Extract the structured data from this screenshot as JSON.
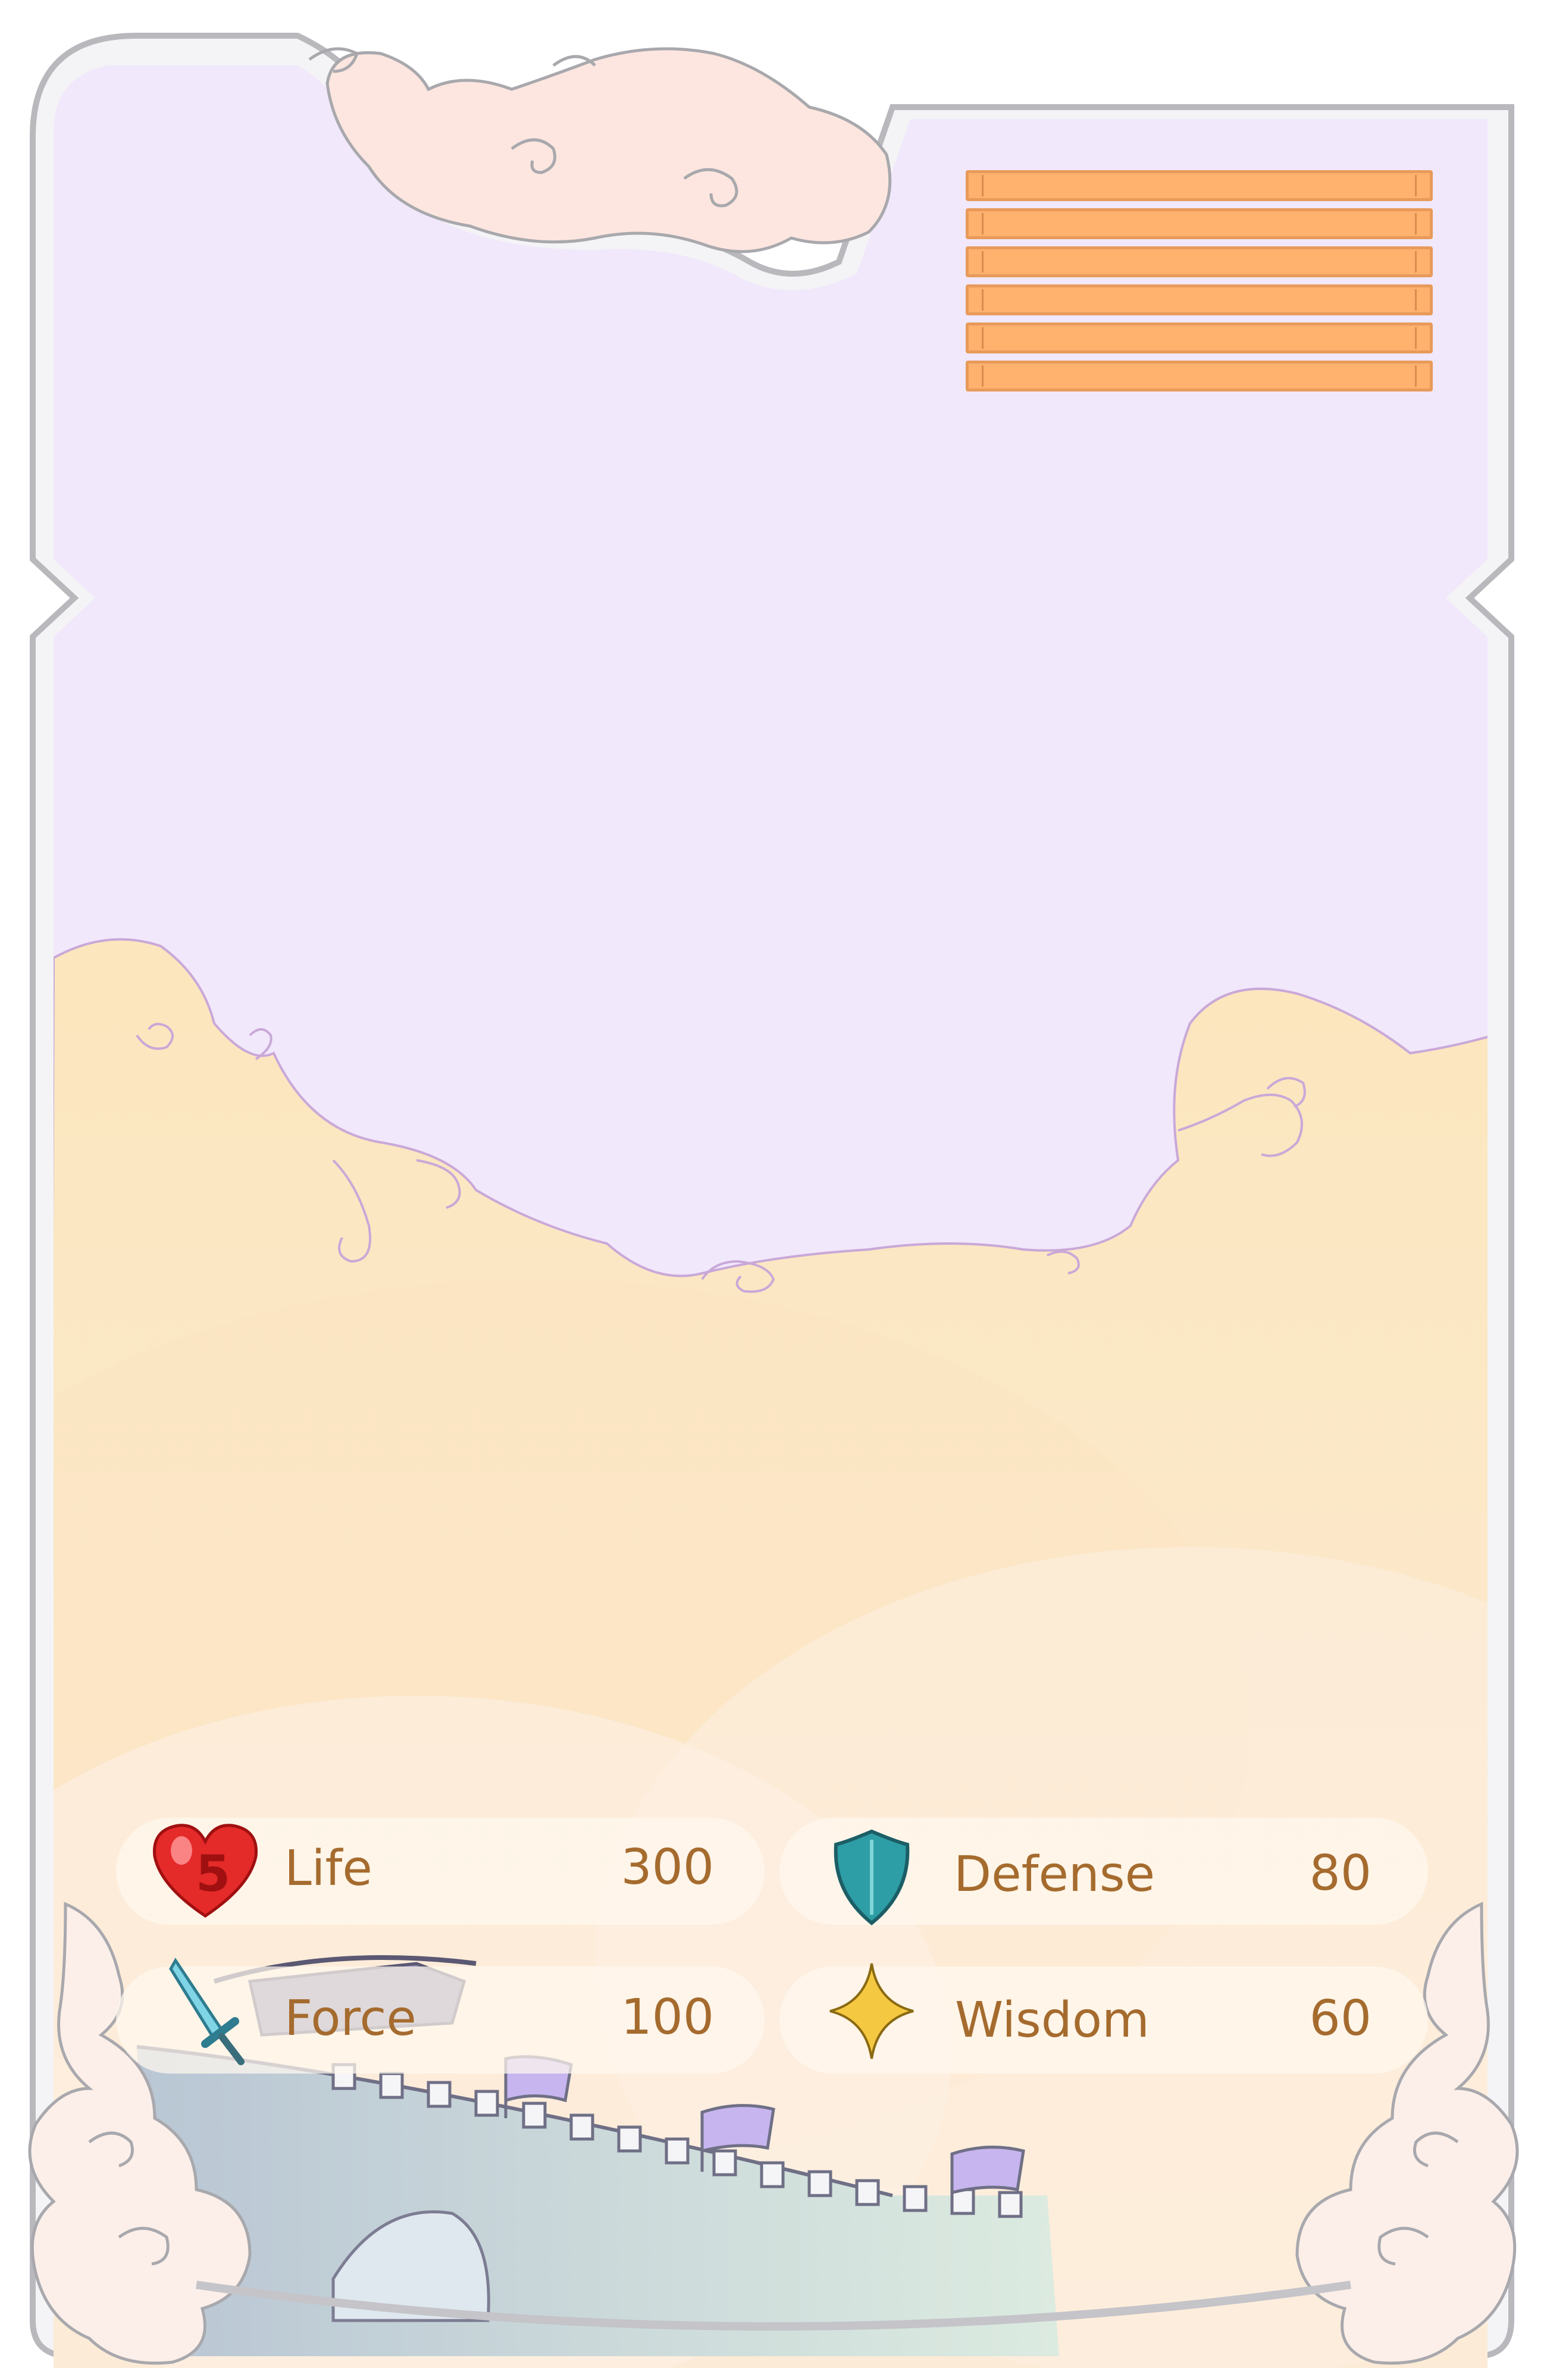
{
  "card": {
    "name_plate_planks": 6,
    "colors": {
      "frame": "#c9c9cc",
      "sky": "#f1e8fb",
      "cloud_sea": "#fbe6c2",
      "plank": "#ffb16e",
      "label_text": "#a56b2e",
      "wall_flag": "#c6b5ee"
    }
  },
  "stats": {
    "life": {
      "label": "Life",
      "value": "300",
      "icon": "heart-icon",
      "badge": "5"
    },
    "defense": {
      "label": "Defense",
      "value": "80",
      "icon": "shield-icon"
    },
    "force": {
      "label": "Force",
      "value": "100",
      "icon": "sword-icon"
    },
    "wisdom": {
      "label": "Wisdom",
      "value": "60",
      "icon": "sparkle-star-icon"
    }
  }
}
